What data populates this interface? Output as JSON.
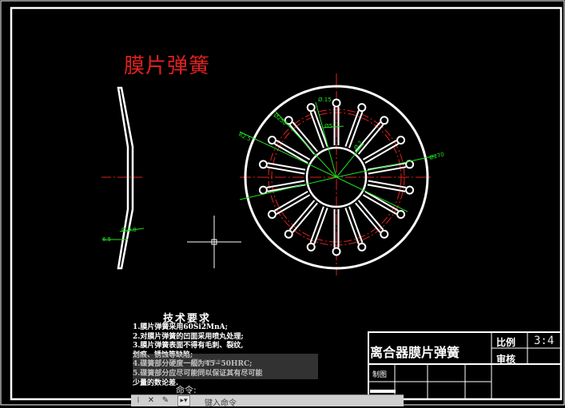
{
  "drawing": {
    "title": "膜片弹簧",
    "dimensions": [
      "Ø.15",
      "Ø250",
      "R2.5",
      "Ø5",
      "Ø.2",
      "Ø270",
      "6.5",
      "Ø.9.8"
    ]
  },
  "tech_requirements": {
    "heading": "技术要求",
    "lines": [
      "1.膜片弹簧采用60Si2MnA;",
      "2.对膜片弹簧的凹面采用喷丸处理;",
      "3.膜片弹簧表面不得有毛刺、裂纹,",
      "划痕、锈蚀等缺陷;",
      "4.碟簧部分硬度一般为45~50HRC;",
      "5.碟簧部分应尽可能同以保证其有尽可能",
      "少量的数论差."
    ]
  },
  "title_block": {
    "name": "离合器膜片弹簧",
    "scale_label": "比例",
    "scale_value": "3:4",
    "check_label": "审核",
    "drawn_label": "制图"
  },
  "command": {
    "history": [
      "改 ****",
      "****"
    ],
    "current": "命令:",
    "placeholder": "键入命令"
  },
  "colors": {
    "background": "#000000",
    "geometry": "#ffffff",
    "centerline": "#e02020",
    "dimension": "#20e020"
  }
}
